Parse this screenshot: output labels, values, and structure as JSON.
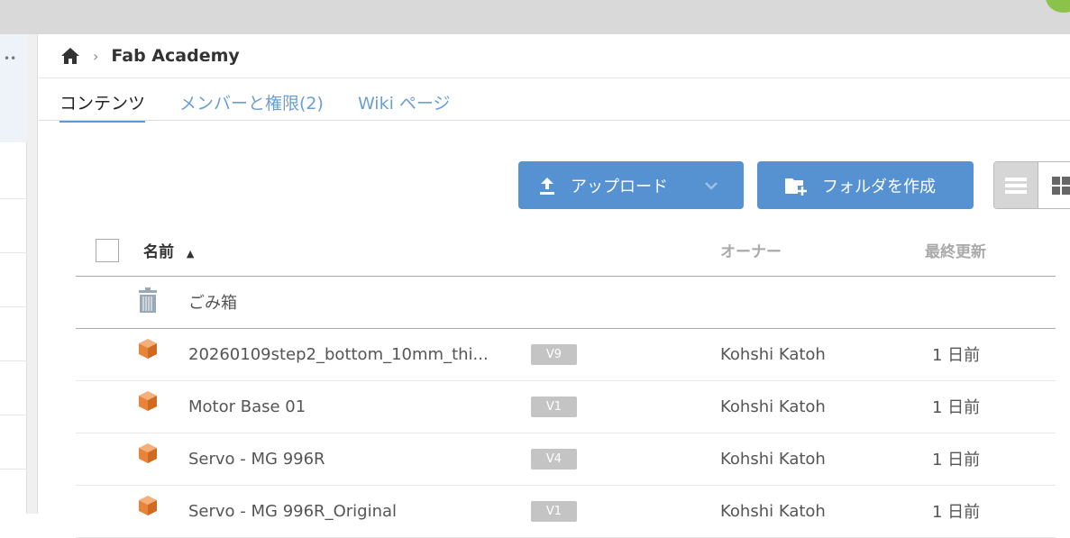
{
  "breadcrumb": {
    "title": "Fab Academy"
  },
  "tabs": [
    {
      "label": "コンテンツ"
    },
    {
      "label": "メンバーと権限(2)"
    },
    {
      "label": "Wiki ページ"
    }
  ],
  "toolbar": {
    "upload_label": "アップロード",
    "create_folder_label": "フォルダを作成"
  },
  "table": {
    "headers": {
      "name": "名前",
      "owner": "オーナー",
      "modified": "最終更新"
    },
    "trash_label": "ごみ箱",
    "rows": [
      {
        "name": "20260109step2_bottom_10mm_thi...",
        "version": "V9",
        "owner": "Kohshi Katoh",
        "modified": "1 日前"
      },
      {
        "name": "Motor Base 01",
        "version": "V1",
        "owner": "Kohshi Katoh",
        "modified": "1 日前"
      },
      {
        "name": "Servo - MG 996R",
        "version": "V4",
        "owner": "Kohshi Katoh",
        "modified": "1 日前"
      },
      {
        "name": "Servo - MG 996R_Original",
        "version": "V1",
        "owner": "Kohshi Katoh",
        "modified": "1 日前"
      }
    ]
  },
  "colors": {
    "accent": "#5692d1",
    "tab_link": "#6a9fd4",
    "model_icon": "#e8843a"
  }
}
